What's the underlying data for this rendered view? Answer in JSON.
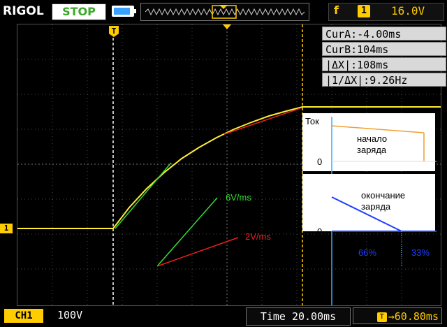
{
  "header": {
    "brand": "RIGOL",
    "run_state": "STOP",
    "trigger_edge_symbol": "f",
    "trigger_channel": "1",
    "trigger_level": "16.0V"
  },
  "cursors": {
    "cur_a": "CurA:-4.00ms",
    "cur_b": "CurB:104ms",
    "delta_x": "|ΔX|:108ms",
    "inv_delta_x": "|1/ΔX|:9.26Hz"
  },
  "markers": {
    "trigger_marker": "T",
    "ch1_marker": "1"
  },
  "annotations": {
    "current_label": "Ток",
    "start_label_1": "начало",
    "start_label_2": "заряда",
    "zero_top": "0",
    "end_label_1": "окончание",
    "end_label_2": "заряда",
    "zero_bottom": "0",
    "slope_green": "6V/ms",
    "slope_red": "2V/ms",
    "pct_66": "66%",
    "pct_33": "33%"
  },
  "footer": {
    "channel_badge": "CH1",
    "volts_per_div": "100V",
    "timebase": "Time 20.00ms",
    "trigger_offset": "→60.80ms"
  },
  "colors": {
    "trace": "#ffee33",
    "accent_yellow": "#ffcc00",
    "stop_green": "#3aa829",
    "orange_line": "#f0a030",
    "blue_line": "#1f3dff",
    "cyan_line": "#3aaaff",
    "green_slope": "#33dd33",
    "red_slope": "#e8221f"
  }
}
